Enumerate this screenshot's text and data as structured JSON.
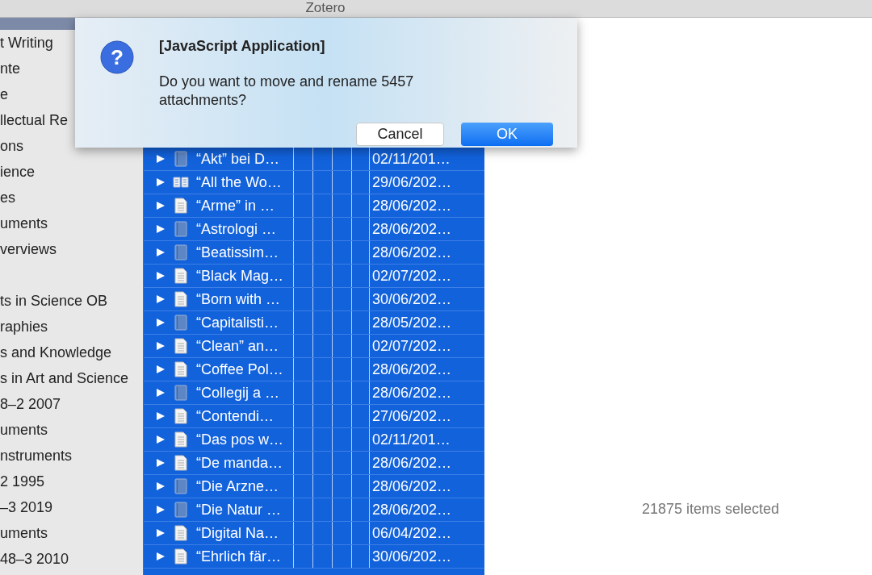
{
  "window": {
    "title": "Zotero"
  },
  "sidebar": {
    "items": [
      {
        "label": "t Writing"
      },
      {
        "label": "nte"
      },
      {
        "label": "e"
      },
      {
        "label": "llectual Re"
      },
      {
        "label": "ons"
      },
      {
        "label": "ience"
      },
      {
        "label": "es"
      },
      {
        "label": "uments"
      },
      {
        "label": "verviews"
      },
      {
        "label": "ts in Science OB",
        "gap_before": true
      },
      {
        "label": "raphies"
      },
      {
        "label": "s and Knowledge"
      },
      {
        "label": "s in Art and Science"
      },
      {
        "label": "8–2 2007"
      },
      {
        "label": "uments"
      },
      {
        "label": "nstruments"
      },
      {
        "label": "2 1995"
      },
      {
        "label": "–3 2019"
      },
      {
        "label": "uments"
      },
      {
        "label": "48–3 2010"
      }
    ]
  },
  "items": {
    "rows": [
      {
        "title": "“Akt” bei D…",
        "date": "02/11/201…",
        "kind": "book",
        "selected": true
      },
      {
        "title": "“All the Wo…",
        "date": "29/06/202…",
        "kind": "open-book",
        "selected": true
      },
      {
        "title": "“Arme” in …",
        "date": "28/06/202…",
        "kind": "document",
        "selected": true
      },
      {
        "title": "“Astrologi …",
        "date": "28/06/202…",
        "kind": "book",
        "selected": true
      },
      {
        "title": "“Beatissim…",
        "date": "28/06/202…",
        "kind": "book",
        "selected": true
      },
      {
        "title": "“Black Mag…",
        "date": "02/07/202…",
        "kind": "document",
        "selected": true
      },
      {
        "title": "“Born with …",
        "date": "30/06/202…",
        "kind": "document",
        "selected": true
      },
      {
        "title": "“Capitalisti…",
        "date": "28/05/202…",
        "kind": "book",
        "selected": true
      },
      {
        "title": "“Clean” an…",
        "date": "02/07/202…",
        "kind": "document",
        "selected": true
      },
      {
        "title": "“Coffee Pol…",
        "date": "28/06/202…",
        "kind": "document",
        "selected": true
      },
      {
        "title": "“Collegij a …",
        "date": "28/06/202…",
        "kind": "book",
        "selected": true
      },
      {
        "title": "“Contendi…",
        "date": "27/06/202…",
        "kind": "document",
        "selected": true
      },
      {
        "title": "“Das pos w…",
        "date": "02/11/201…",
        "kind": "document",
        "selected": true
      },
      {
        "title": "“De manda…",
        "date": "28/06/202…",
        "kind": "document",
        "selected": true
      },
      {
        "title": "“Die Arzne…",
        "date": "28/06/202…",
        "kind": "book",
        "selected": true
      },
      {
        "title": "“Die Natur …",
        "date": "28/06/202…",
        "kind": "book",
        "selected": true
      },
      {
        "title": "“Digital Na…",
        "date": "06/04/202…",
        "kind": "document",
        "selected": true
      },
      {
        "title": "“Ehrlich fär…",
        "date": "30/06/202…",
        "kind": "document",
        "selected": true
      }
    ]
  },
  "status": "21875 items selected",
  "dialog": {
    "icon_glyph": "?",
    "title": "[JavaScript Application]",
    "message": "Do you want to move and rename 5457 attachments?",
    "buttons": [
      {
        "label": "Cancel",
        "kind": "secondary"
      },
      {
        "label": "OK",
        "kind": "primary"
      }
    ]
  }
}
